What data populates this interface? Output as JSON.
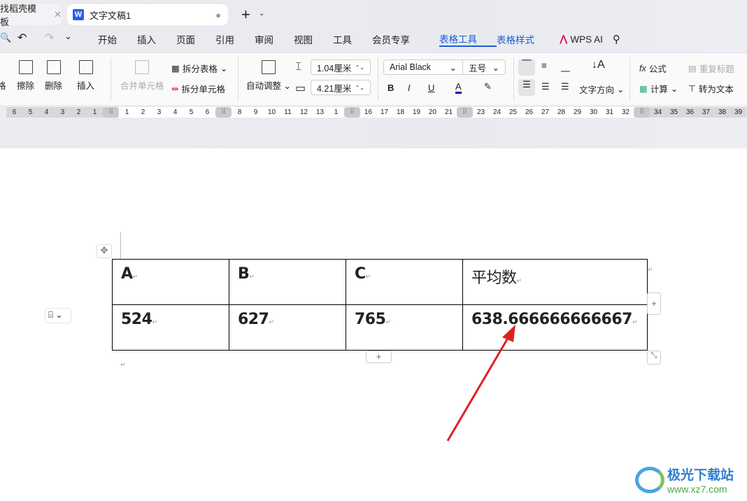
{
  "tabs": [
    {
      "label": "找稻壳模板"
    },
    {
      "label": "文字文稿1",
      "icon": "W"
    }
  ],
  "menu": [
    "开始",
    "插入",
    "页面",
    "引用",
    "审阅",
    "视图",
    "工具",
    "会员专享",
    "表格工具",
    "表格样式"
  ],
  "wps_ai": "WPS AI",
  "ribbon": {
    "draw": "格",
    "erase": "擦除",
    "delete": "删除",
    "insert": "插入",
    "merge": "合并单元格",
    "split_table": "拆分表格",
    "split_cell": "拆分单元格",
    "auto_fit": "自动调整",
    "height": "1.04厘米",
    "width": "4.21厘米",
    "font": "Arial Black",
    "size": "五号",
    "bold": "B",
    "italic": "I",
    "underline": "U",
    "color": "A",
    "text_dir": "文字方向",
    "formula": "公式",
    "repeat_header": "重复标题",
    "calc": "计算",
    "to_text": "转为文本",
    "font_color": "#0000cc"
  },
  "ruler": [
    "6",
    "5",
    "4",
    "3",
    "2",
    "1",
    "H",
    "1",
    "2",
    "3",
    "4",
    "5",
    "6",
    "H",
    "8",
    "9",
    "10",
    "11",
    "12",
    "13",
    "1",
    "H",
    "16",
    "17",
    "18",
    "19",
    "20",
    "21",
    "H",
    "23",
    "24",
    "25",
    "26",
    "27",
    "28",
    "29",
    "30",
    "31",
    "32",
    "H",
    "34",
    "35",
    "36",
    "37",
    "38",
    "39"
  ],
  "table": {
    "header": [
      "A",
      "B",
      "C",
      "平均数"
    ],
    "row": [
      "524",
      "627",
      "765",
      "638.666666666667"
    ]
  },
  "watermark": {
    "name": "极光下载站",
    "url": "www.xz7.com"
  },
  "colors": {
    "accent": "#1a5fd6",
    "arrow": "#e02020"
  }
}
